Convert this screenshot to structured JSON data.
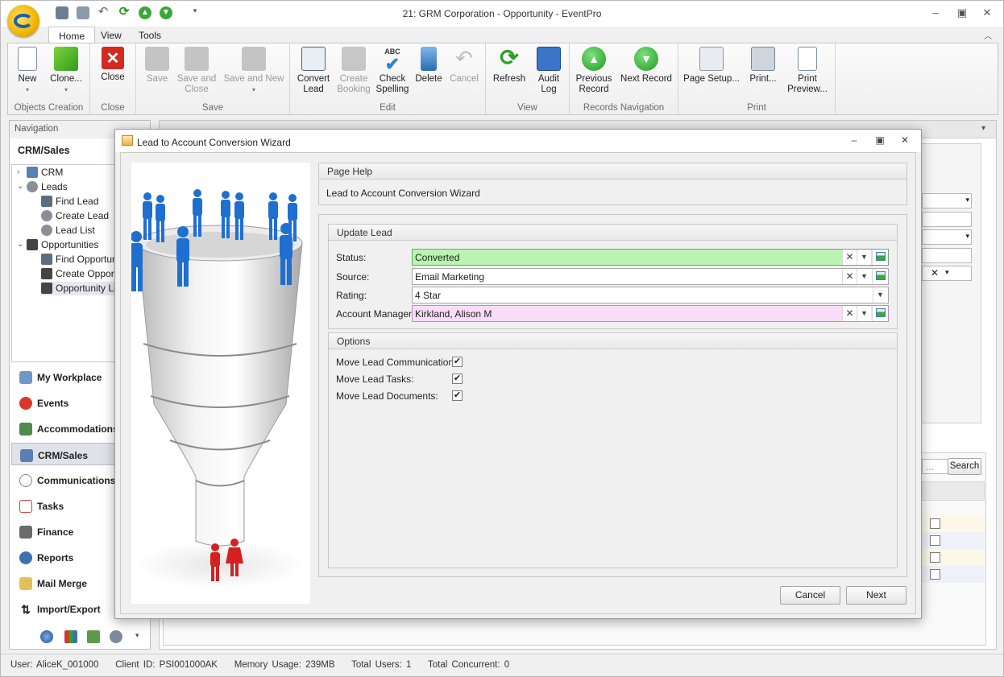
{
  "window": {
    "title": "21: GRM Corporation - Opportunity - EventPro"
  },
  "ribbon": {
    "tabs": [
      "Home",
      "View",
      "Tools"
    ],
    "groups": {
      "objects_creation": {
        "label": "Objects Creation",
        "new": "New",
        "clone": "Clone..."
      },
      "close": {
        "label": "Close",
        "close": "Close"
      },
      "save": {
        "label": "Save",
        "save": "Save",
        "save_close_1": "Save and",
        "save_close_2": "Close",
        "save_new": "Save and New"
      },
      "edit": {
        "label": "Edit",
        "convert_1": "Convert",
        "convert_2": "Lead",
        "create_1": "Create",
        "create_2": "Booking",
        "check_1": "Check",
        "check_2": "Spelling",
        "delete": "Delete",
        "cancel": "Cancel"
      },
      "view": {
        "label": "View",
        "refresh": "Refresh",
        "audit_1": "Audit",
        "audit_2": "Log"
      },
      "records_navigation": {
        "label": "Records Navigation",
        "prev_1": "Previous",
        "prev_2": "Record",
        "next": "Next Record"
      },
      "print": {
        "label": "Print",
        "page_setup": "Page Setup...",
        "print": "Print...",
        "preview_1": "Print",
        "preview_2": "Preview..."
      }
    },
    "check_icon_text": "ABC"
  },
  "navigation": {
    "header": "Navigation",
    "section": "CRM/Sales",
    "tree": {
      "crm": "CRM",
      "leads": "Leads",
      "find_lead": "Find Lead",
      "create_lead": "Create Lead",
      "lead_list": "Lead List",
      "opportunities": "Opportunities",
      "find_opportunity": "Find Opportuni",
      "create_opportunity": "Create Opport",
      "opportunity_list": "Opportunity Lis"
    },
    "buttons": {
      "my_workplace": "My Workplace",
      "events": "Events",
      "accommodations": "Accommodations",
      "crm_sales": "CRM/Sales",
      "communications": "Communications",
      "tasks": "Tasks",
      "finance": "Finance",
      "reports": "Reports",
      "mail_merge": "Mail Merge",
      "import_export": "Import/Export"
    }
  },
  "background": {
    "search_placeholder": "...",
    "search_button": "Search"
  },
  "dialog": {
    "title": "Lead to Account Conversion Wizard",
    "page_help": {
      "header": "Page Help",
      "text": "Lead to Account Conversion Wizard"
    },
    "update_lead": {
      "header": "Update Lead",
      "status_label": "Status:",
      "status_value": "Converted",
      "source_label": "Source:",
      "source_value": "Email Marketing",
      "rating_label": "Rating:",
      "rating_value": "4 Star",
      "manager_label": "Account Manager:",
      "manager_value": "Kirkland, Alison M"
    },
    "options": {
      "header": "Options",
      "move_comms": "Move Lead Communications:",
      "move_tasks": "Move Lead Tasks:",
      "move_docs": "Move Lead Documents:",
      "move_comms_checked": true,
      "move_tasks_checked": true,
      "move_docs_checked": true
    },
    "buttons": {
      "cancel": "Cancel",
      "next": "Next"
    }
  },
  "status_bar": {
    "user": "User: AliceK_001000",
    "client": "Client ID: PSI001000AK",
    "memory": "Memory Usage: 239MB",
    "total_users": "Total Users: 1",
    "total_concurrent": "Total Concurrent: 0"
  },
  "colors": {
    "status_field": "#b9f5b0",
    "manager_field": "#f8dcf8",
    "accent_blue": "#1a6fc9"
  }
}
